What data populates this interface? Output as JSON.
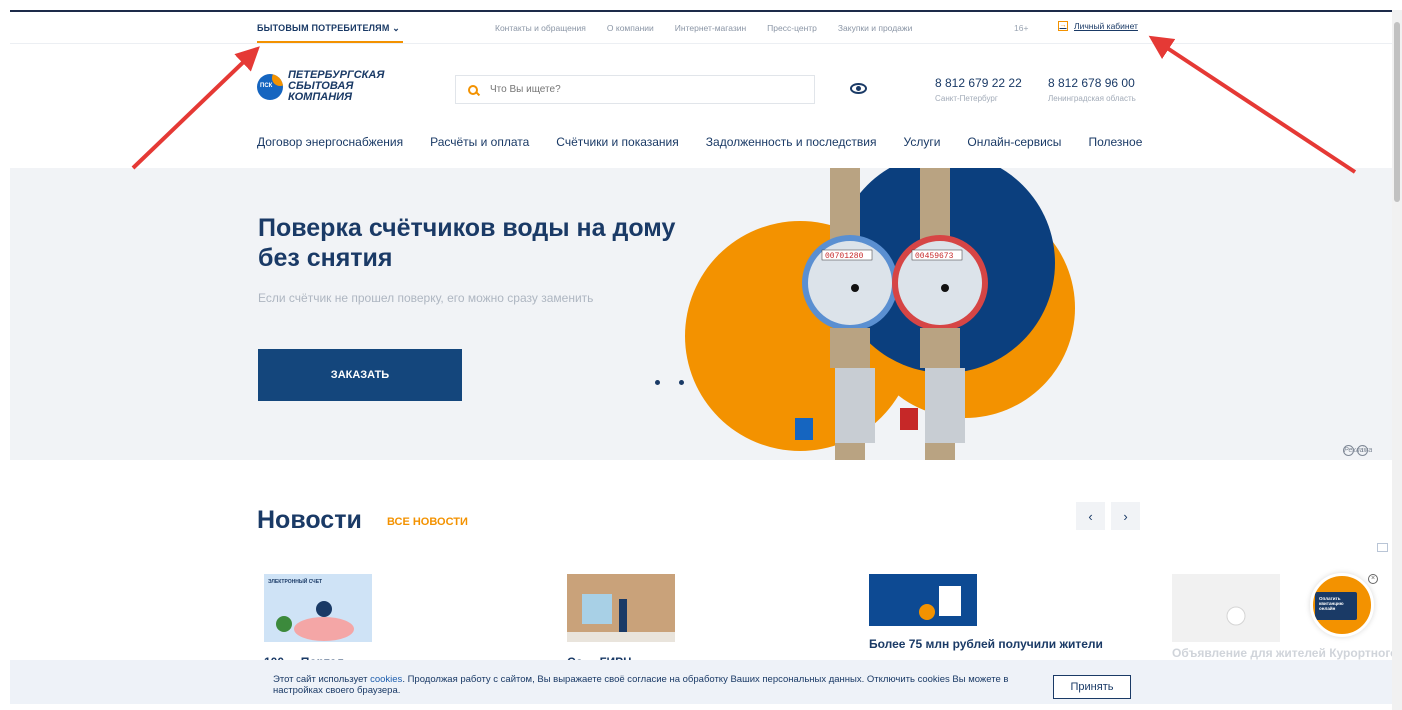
{
  "topbar": {
    "consumer_label": "БЫТОВЫМ ПОТРЕБИТЕЛЯМ",
    "links": [
      "Контакты и обращения",
      "О компании",
      "Интернет-магазин",
      "Пресс-центр",
      "Закупки и продажи"
    ],
    "age": "16+",
    "cabinet": "Личный кабинет"
  },
  "header": {
    "logo_badge": "ПСК",
    "logo_lines": [
      "ПЕТЕРБУРГСКАЯ",
      "СБЫТОВАЯ",
      "КОМПАНИЯ"
    ],
    "search_placeholder": "Что Вы ищете?",
    "phones": [
      {
        "number": "8 812 679 22 22",
        "region": "Санкт-Петербург"
      },
      {
        "number": "8 812 678 96 00",
        "region": "Ленинградская область"
      }
    ]
  },
  "nav": [
    "Договор энергоснабжения",
    "Расчёты и оплата",
    "Счётчики и показания",
    "Задолженность и последствия",
    "Услуги",
    "Онлайн-сервисы",
    "Полезное"
  ],
  "hero": {
    "title": "Поверка счётчиков воды на дому без снятия",
    "subtitle": "Если счётчик не прошел поверку, его можно сразу заменить",
    "button": "ЗАКАЗАТЬ",
    "ad": "Реклама",
    "ad_icon": "i",
    "slides": 5,
    "active_slide": 4,
    "meter_readings": [
      "00701280",
      "00459673"
    ]
  },
  "news": {
    "title": "Новости",
    "all_link": "ВСЕ НОВОСТИ",
    "prev": "‹",
    "next": "›",
    "items": [
      {
        "img_caption": "ЭЛЕКТРОННЫЙ СЧЕТ",
        "title": "100 ... Портал ..."
      },
      {
        "img_caption": "",
        "title": "Со ... ГИРЦ"
      },
      {
        "img_caption": "",
        "title": "Более 75 млн рублей получили жители"
      },
      {
        "img_caption": "",
        "title": "Объявление для жителей Курортного"
      }
    ]
  },
  "pay_widget": {
    "label": "Оплатить квитанцию онлайн",
    "close": "×"
  },
  "cookie": {
    "text_before": "Этот сайт использует ",
    "link": "cookies",
    "text_after": ". Продолжая работу с сайтом, Вы выражаете своё согласие на обработку Ваших персональных данных. Отключить cookies Вы можете в настройках своего браузера.",
    "accept": "Принять"
  },
  "colors": {
    "brand_blue": "#1a3a66",
    "accent_orange": "#f39200",
    "arrow_red": "#e53935"
  }
}
